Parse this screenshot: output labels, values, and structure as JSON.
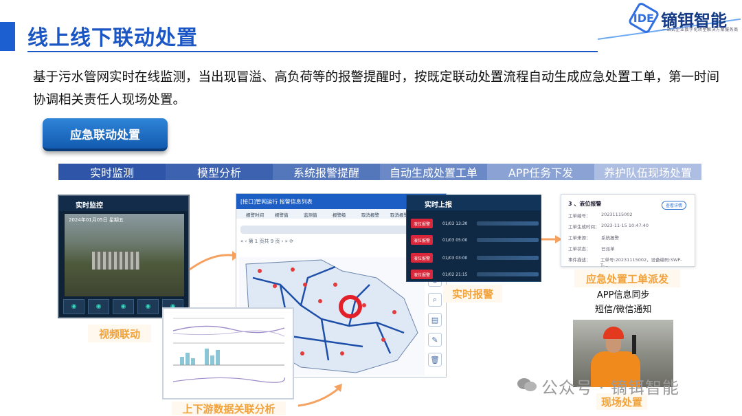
{
  "header": {
    "title": "线上线下联动处置",
    "logo_mark": "IDE",
    "logo_text": "镝铒智能",
    "logo_sub": "一站式企业数字化转型解决方案服务商"
  },
  "description": "基于污水管网实时在线监测，当出现冒溢、高负荷等的报警提醒时，按既定联动处置流程自动生成应急处置工单，第一时间协调相关责任人现场处置。",
  "emergency_button": "应急联动处置",
  "steps": [
    "实时监测",
    "模型分析",
    "系统报警提醒",
    "自动生成处置工单",
    "APP任务下发",
    "养护队伍现场处置"
  ],
  "video_panel": {
    "title": "实时监控",
    "timestamp": "2024年01月05日 星期五"
  },
  "labels": {
    "video": "视频联动",
    "analysis": "上下游数据关联分析",
    "alarm": "实时报警",
    "dispatch": "应急处置工单派发",
    "field": "现场处置"
  },
  "map_panel": {
    "title": "[接口]管网运行 报警信息列表",
    "columns": [
      "报警时间",
      "报警值",
      "监测值",
      "报警级",
      "取消报警",
      "取消报警"
    ],
    "pager": "第 1 页共 9 页"
  },
  "report_panel": {
    "title": "实时上报",
    "rows": [
      {
        "tag": "液位报警",
        "time": "01/03 13:30"
      },
      {
        "tag": "液位报警",
        "time": "01/03 05:00"
      },
      {
        "tag": "液位报警",
        "time": "01/03 03:00"
      },
      {
        "tag": "液位报警",
        "time": "01/02 21:15"
      }
    ]
  },
  "work_order": {
    "title": "3 、液位报警",
    "button": "查看详情",
    "rows": [
      {
        "k": "工单编号：",
        "v": "20231115002"
      },
      {
        "k": "工单生成时间：",
        "v": "2023-11-15 10:47:40"
      },
      {
        "k": "工单来源：",
        "v": "系统报警"
      },
      {
        "k": "工单状态：",
        "v": "已派单"
      },
      {
        "k": "事件描述：",
        "v": "工单号:20231115002，设备编码:SWP-T-..."
      }
    ]
  },
  "app_sync": [
    "APP信息同步",
    "短信/微信通知"
  ],
  "watermark": "公众号 · 镝铒智能",
  "colors": {
    "title_blue": "#1a56c4",
    "orange_label": "#f2a23a",
    "alarm_red": "#d8263a"
  }
}
